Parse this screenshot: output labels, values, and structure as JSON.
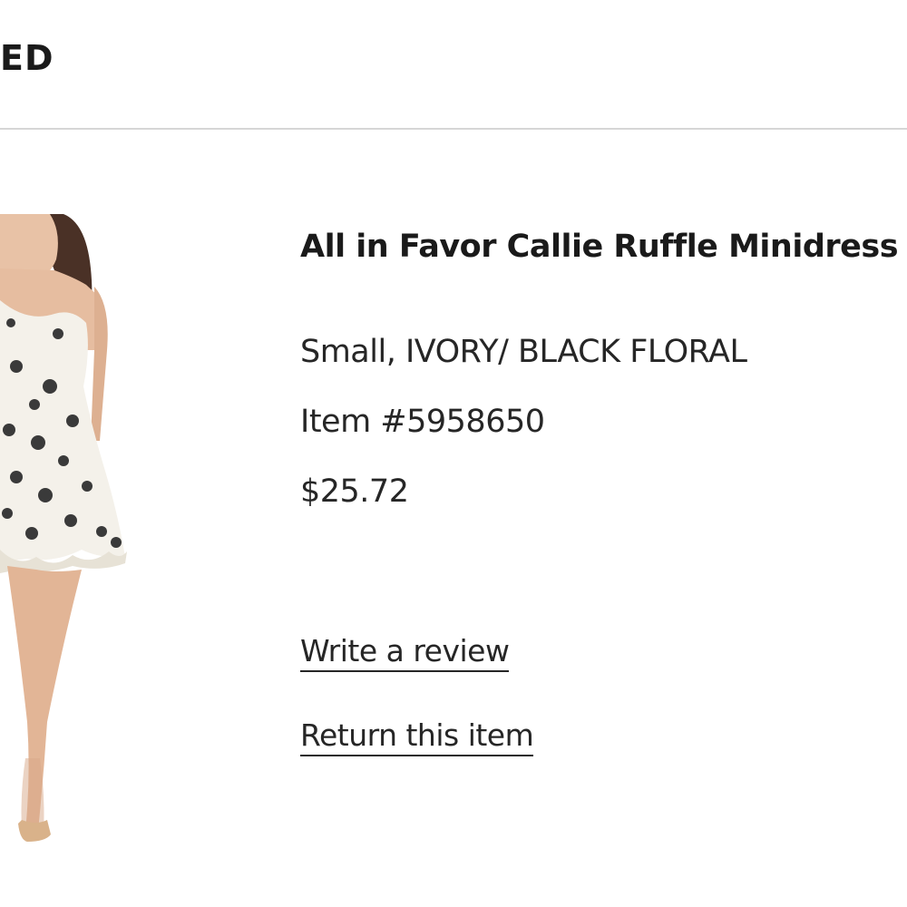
{
  "header": {
    "status_text": "ED"
  },
  "product": {
    "title": "All in Favor Callie Ruffle Minidress",
    "variant": "Small, IVORY/ BLACK FLORAL",
    "item_number": "Item #5958650",
    "price": "$25.72",
    "image": "dress-model-photo"
  },
  "actions": {
    "write_review": "Write a review",
    "return_item": "Return this item"
  },
  "colors": {
    "text": "#1f1f1f",
    "divider": "#d6d6d6",
    "background": "#ffffff"
  }
}
